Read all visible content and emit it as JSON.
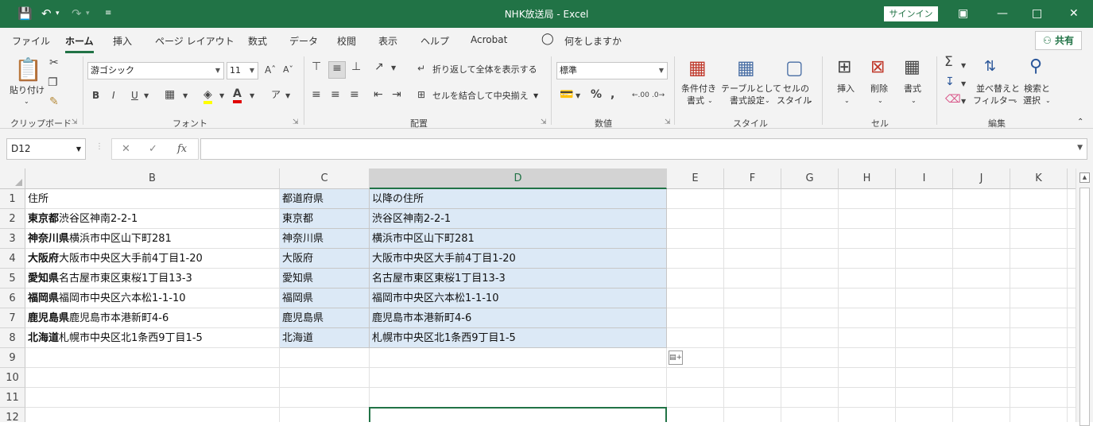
{
  "app": {
    "title": "NHK放送局  -  Excel",
    "signin_label": "サインイン",
    "share_label": "共有",
    "accent_color": "#217346"
  },
  "tabs": [
    "ファイル",
    "ホーム",
    "挿入",
    "ページ レイアウト",
    "数式",
    "データ",
    "校閲",
    "表示",
    "ヘルプ",
    "Acrobat"
  ],
  "active_tab": "ホーム",
  "tell_me": "何をしますか",
  "ribbon": {
    "clipboard": {
      "paste_label": "貼り付け",
      "group_label": "クリップボード"
    },
    "font": {
      "font_name": "游ゴシック",
      "font_size": "11",
      "group_label": "フォント",
      "bold": "B",
      "italic": "I",
      "underline": "U"
    },
    "alignment": {
      "wrap_label": "折り返して全体を表示する",
      "merge_label": "セルを結合して中央揃え",
      "group_label": "配置"
    },
    "number": {
      "format": "標準",
      "group_label": "数値"
    },
    "styles": {
      "conditional_label1": "条件付き",
      "conditional_label2": "書式",
      "table_label1": "テーブルとして",
      "table_label2": "書式設定",
      "cell_style_label1": "セルの",
      "cell_style_label2": "スタイル",
      "group_label": "スタイル"
    },
    "cells": {
      "insert_label": "挿入",
      "delete_label": "削除",
      "format_label": "書式",
      "group_label": "セル"
    },
    "editing": {
      "sort_label1": "並べ替えと",
      "sort_label2": "フィルター",
      "find_label1": "検索と",
      "find_label2": "選択",
      "group_label": "編集"
    }
  },
  "formula_bar": {
    "name_box": "D12",
    "fx": "fx",
    "content": ""
  },
  "sheet": {
    "columns": [
      "B",
      "C",
      "D",
      "E",
      "F",
      "G",
      "H",
      "I",
      "J",
      "K"
    ],
    "selected_column": "D",
    "rows": [
      {
        "n": "1",
        "b_bold": "",
        "b_rest": "住所",
        "c": "都道府県",
        "d": "以降の住所"
      },
      {
        "n": "2",
        "b_bold": "東京都",
        "b_rest": "渋谷区神南2-2-1",
        "c": "東京都",
        "d": "渋谷区神南2-2-1"
      },
      {
        "n": "3",
        "b_bold": "神奈川県",
        "b_rest": "横浜市中区山下町281",
        "c": "神奈川県",
        "d": "横浜市中区山下町281"
      },
      {
        "n": "4",
        "b_bold": "大阪府",
        "b_rest": "大阪市中央区大手前4丁目1-20",
        "c": "大阪府",
        "d": "大阪市中央区大手前4丁目1-20"
      },
      {
        "n": "5",
        "b_bold": "愛知県",
        "b_rest": "名古屋市東区東桜1丁目13-3",
        "c": "愛知県",
        "d": "名古屋市東区東桜1丁目13-3"
      },
      {
        "n": "6",
        "b_bold": "福岡県",
        "b_rest": "福岡市中央区六本松1-1-10",
        "c": "福岡県",
        "d": "福岡市中央区六本松1-1-10"
      },
      {
        "n": "7",
        "b_bold": "鹿児島県",
        "b_rest": "鹿児島市本港新町4-6",
        "c": "鹿児島県",
        "d": "鹿児島市本港新町4-6"
      },
      {
        "n": "8",
        "b_bold": "北海道",
        "b_rest": "札幌市中央区北1条西9丁目1-5",
        "c": "北海道",
        "d": "札幌市中央区北1条西9丁目1-5"
      },
      {
        "n": "9",
        "b_bold": "",
        "b_rest": "",
        "c": "",
        "d": ""
      },
      {
        "n": "10",
        "b_bold": "",
        "b_rest": "",
        "c": "",
        "d": ""
      },
      {
        "n": "11",
        "b_bold": "",
        "b_rest": "",
        "c": "",
        "d": ""
      },
      {
        "n": "12",
        "b_bold": "",
        "b_rest": "",
        "c": "",
        "d": ""
      }
    ]
  }
}
